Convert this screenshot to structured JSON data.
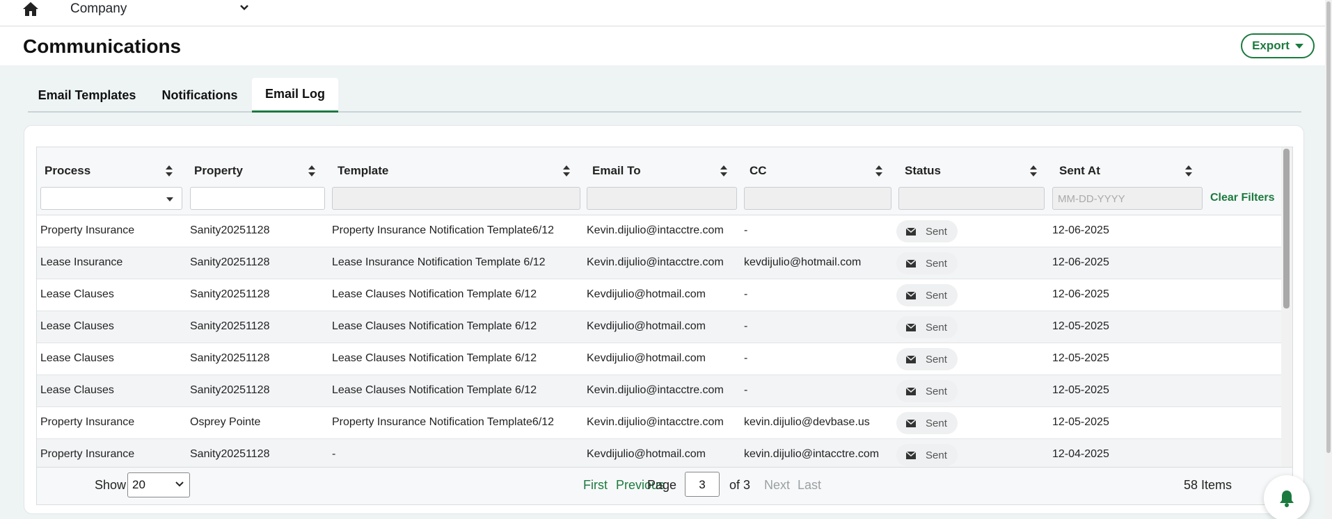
{
  "topbar": {
    "company_label": "Company"
  },
  "header": {
    "title": "Communications",
    "export_label": "Export"
  },
  "tabs": [
    {
      "label": "Email Templates",
      "active": false
    },
    {
      "label": "Notifications",
      "active": false
    },
    {
      "label": "Email Log",
      "active": true
    }
  ],
  "grid": {
    "columns": [
      "Process",
      "Property",
      "Template",
      "Email To",
      "CC",
      "Status",
      "Sent At"
    ],
    "filters": {
      "sent_at_placeholder": "MM-DD-YYYY",
      "clear_filters_label": "Clear Filters"
    },
    "rows": [
      {
        "process": "Property Insurance",
        "property": "Sanity20251128",
        "template": "Property Insurance Notification Template6/12",
        "email_to": "Kevin.dijulio@intacctre.com",
        "cc": "-",
        "status": "Sent",
        "sent_at": "12-06-2025"
      },
      {
        "process": "Lease Insurance",
        "property": "Sanity20251128",
        "template": "Lease Insurance Notification Template 6/12",
        "email_to": "Kevin.dijulio@intacctre.com",
        "cc": "kevdijulio@hotmail.com",
        "status": "Sent",
        "sent_at": "12-06-2025"
      },
      {
        "process": "Lease Clauses",
        "property": "Sanity20251128",
        "template": "Lease Clauses Notification Template 6/12",
        "email_to": "Kevdijulio@hotmail.com",
        "cc": "-",
        "status": "Sent",
        "sent_at": "12-06-2025"
      },
      {
        "process": "Lease Clauses",
        "property": "Sanity20251128",
        "template": "Lease Clauses Notification Template 6/12",
        "email_to": "Kevdijulio@hotmail.com",
        "cc": "-",
        "status": "Sent",
        "sent_at": "12-05-2025"
      },
      {
        "process": "Lease Clauses",
        "property": "Sanity20251128",
        "template": "Lease Clauses Notification Template 6/12",
        "email_to": "Kevdijulio@hotmail.com",
        "cc": "-",
        "status": "Sent",
        "sent_at": "12-05-2025"
      },
      {
        "process": "Lease Clauses",
        "property": "Sanity20251128",
        "template": "Lease Clauses Notification Template 6/12",
        "email_to": "Kevin.dijulio@intacctre.com",
        "cc": "-",
        "status": "Sent",
        "sent_at": "12-05-2025"
      },
      {
        "process": "Property Insurance",
        "property": "Osprey Pointe",
        "template": "Property Insurance Notification Template6/12",
        "email_to": "Kevin.dijulio@intacctre.com",
        "cc": "kevin.dijulio@devbase.us",
        "status": "Sent",
        "sent_at": "12-05-2025"
      },
      {
        "process": "Property Insurance",
        "property": "Sanity20251128",
        "template": "-",
        "email_to": "Kevdijulio@hotmail.com",
        "cc": "kevin.dijulio@intacctre.com",
        "status": "Sent",
        "sent_at": "12-04-2025"
      }
    ]
  },
  "pagination": {
    "show_label": "Show",
    "page_size": "20",
    "first": "First",
    "previous": "Previous",
    "page_label": "Page",
    "current_page": "3",
    "of_label": "of 3",
    "next": "Next",
    "last": "Last",
    "items_count": "58 Items"
  },
  "colors": {
    "accent": "#1b7a3e",
    "background": "#eef3f4"
  },
  "icons": [
    "home-icon",
    "chevron-down-icon",
    "caret-down-icon",
    "sort-icon",
    "envelope-icon",
    "bell-icon"
  ]
}
